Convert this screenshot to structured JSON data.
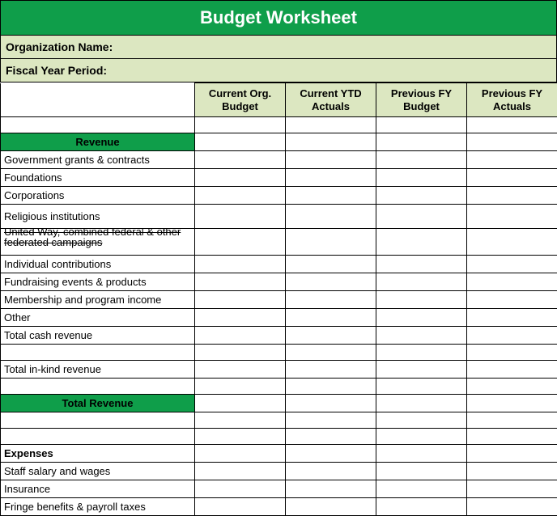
{
  "title": "Budget Worksheet",
  "meta": {
    "org_label": "Organization Name:",
    "fy_label": "Fiscal Year Period:"
  },
  "columns": [
    "Current Org. Budget",
    "Current YTD Actuals",
    "Previous FY Budget",
    "Previous FY Actuals"
  ],
  "sections": {
    "revenue_header": "Revenue",
    "total_revenue_header": "Total Revenue",
    "expenses_header": "Expenses"
  },
  "revenue_rows": [
    "Government grants & contracts",
    "Foundations",
    "Corporations",
    "Religious institutions",
    "United Way, combined federal & other federated campaigns",
    "Individual contributions",
    "Fundraising events & products",
    "Membership and program income",
    "Other",
    "Total cash revenue",
    "",
    "Total in-kind revenue",
    ""
  ],
  "expense_rows": [
    "Staff salary and wages",
    "Insurance",
    "Fringe benefits & payroll taxes"
  ]
}
